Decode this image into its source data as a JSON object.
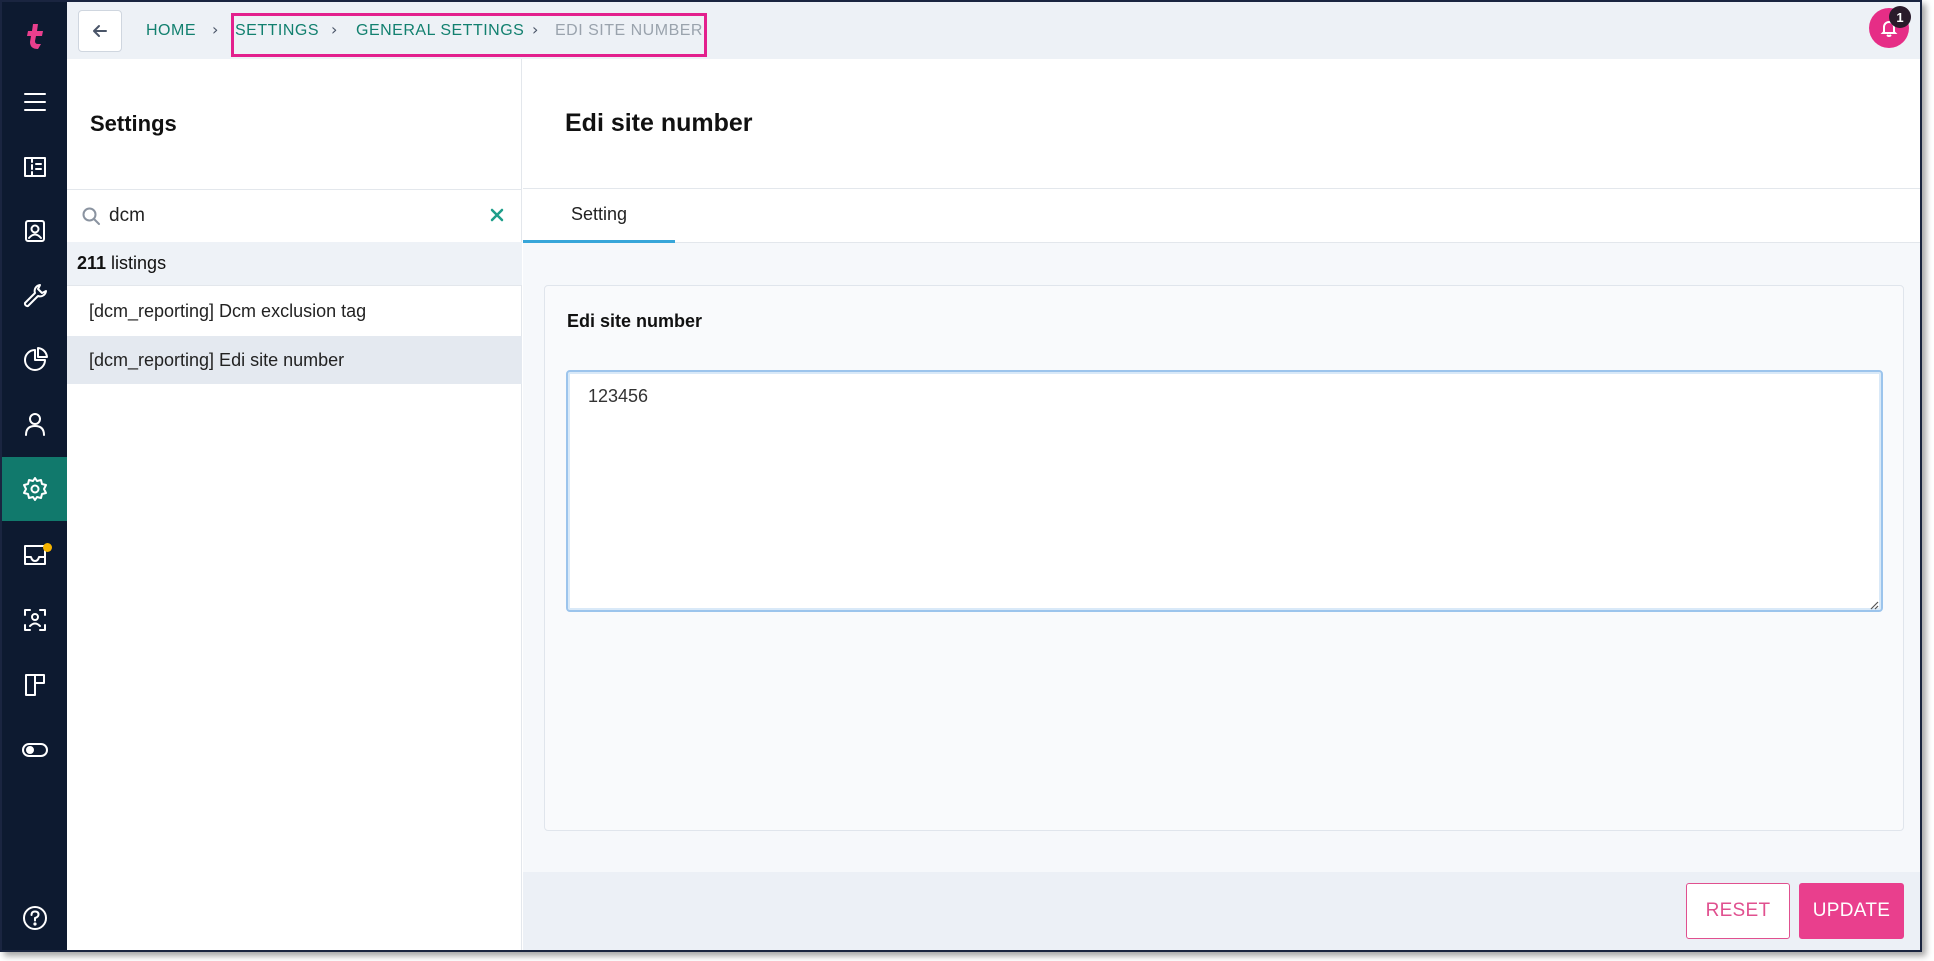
{
  "rail": {
    "items": [
      {
        "icon": "logo-icon"
      },
      {
        "icon": "menu-icon"
      },
      {
        "icon": "ticket-icon"
      },
      {
        "icon": "contact-card-icon"
      },
      {
        "icon": "wrench-icon"
      },
      {
        "icon": "pie-chart-icon"
      },
      {
        "icon": "user-icon"
      },
      {
        "icon": "gear-icon"
      },
      {
        "icon": "inbox-icon"
      },
      {
        "icon": "face-scan-icon"
      },
      {
        "icon": "board-icon"
      },
      {
        "icon": "toggle-icon"
      },
      {
        "icon": "help-icon"
      }
    ],
    "active": "gear-icon",
    "accent": "#11796c"
  },
  "topbar": {
    "breadcrumb": {
      "home": "HOME",
      "settings": "SETTINGS",
      "general": "GENERAL SETTINGS",
      "current": "EDI SITE NUMBER"
    },
    "notification_count": "1"
  },
  "list": {
    "title": "Settings",
    "search_value": "dcm",
    "count": "211",
    "count_label": "listings",
    "items": [
      {
        "label": "[dcm_reporting] Dcm exclusion tag"
      },
      {
        "label": "[dcm_reporting] Edi site number"
      }
    ]
  },
  "main": {
    "title": "Edi site number",
    "tab": "Setting",
    "field_label": "Edi site number",
    "field_value": "123456",
    "reset_label": "RESET",
    "update_label": "UPDATE"
  },
  "colors": {
    "brand_pink": "#e93f8d",
    "link_green": "#12806f",
    "rail_bg": "#0d1a30"
  }
}
